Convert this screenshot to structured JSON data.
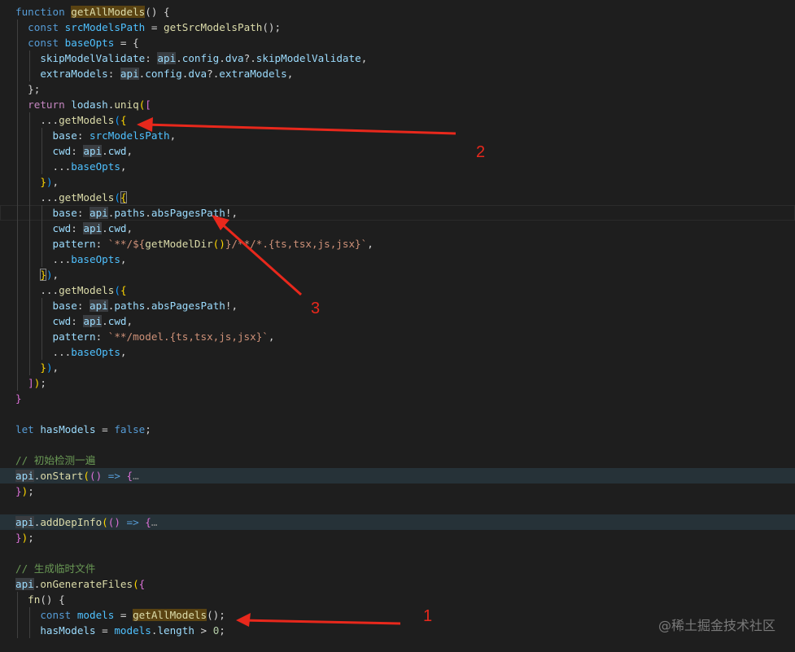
{
  "editor": {
    "lines": [
      {
        "indent": 0,
        "tokens": [
          [
            "function ",
            "kw"
          ],
          [
            "getAllModels",
            "fn",
            "match"
          ],
          [
            "() {",
            "plain"
          ]
        ]
      },
      {
        "indent": 1,
        "tokens": [
          [
            "const ",
            "kw"
          ],
          [
            "srcModelsPath",
            "const"
          ],
          [
            " = ",
            "plain"
          ],
          [
            "getSrcModelsPath",
            "fn"
          ],
          [
            "();",
            "plain"
          ]
        ]
      },
      {
        "indent": 1,
        "tokens": [
          [
            "const ",
            "kw"
          ],
          [
            "baseOpts",
            "const"
          ],
          [
            " = {",
            "plain"
          ]
        ]
      },
      {
        "indent": 2,
        "tokens": [
          [
            "skipModelValidate",
            "var"
          ],
          [
            ": ",
            "plain"
          ],
          [
            "api",
            "var",
            "api"
          ],
          [
            ".",
            "plain"
          ],
          [
            "config",
            "var"
          ],
          [
            ".",
            "plain"
          ],
          [
            "dva",
            "var"
          ],
          [
            "?.",
            "plain"
          ],
          [
            "skipModelValidate",
            "var"
          ],
          [
            ",",
            "plain"
          ]
        ]
      },
      {
        "indent": 2,
        "tokens": [
          [
            "extraModels",
            "var"
          ],
          [
            ": ",
            "plain"
          ],
          [
            "api",
            "var",
            "api"
          ],
          [
            ".",
            "plain"
          ],
          [
            "config",
            "var"
          ],
          [
            ".",
            "plain"
          ],
          [
            "dva",
            "var"
          ],
          [
            "?.",
            "plain"
          ],
          [
            "extraModels",
            "var"
          ],
          [
            ",",
            "plain"
          ]
        ]
      },
      {
        "indent": 1,
        "tokens": [
          [
            "};",
            "plain"
          ]
        ]
      },
      {
        "indent": 1,
        "tokens": [
          [
            "return ",
            "ctrl"
          ],
          [
            "lodash",
            "var"
          ],
          [
            ".",
            "plain"
          ],
          [
            "uniq",
            "fn"
          ],
          [
            "(",
            "p1"
          ],
          [
            "[",
            "p2"
          ]
        ]
      },
      {
        "indent": 2,
        "tokens": [
          [
            "...",
            "plain"
          ],
          [
            "getModels",
            "fn"
          ],
          [
            "(",
            "p3"
          ],
          [
            "{",
            "p1"
          ]
        ]
      },
      {
        "indent": 3,
        "tokens": [
          [
            "base",
            "var"
          ],
          [
            ": ",
            "plain"
          ],
          [
            "srcModelsPath",
            "const"
          ],
          [
            ",",
            "plain"
          ]
        ]
      },
      {
        "indent": 3,
        "tokens": [
          [
            "cwd",
            "var"
          ],
          [
            ": ",
            "plain"
          ],
          [
            "api",
            "var",
            "api"
          ],
          [
            ".",
            "plain"
          ],
          [
            "cwd",
            "var"
          ],
          [
            ",",
            "plain"
          ]
        ]
      },
      {
        "indent": 3,
        "tokens": [
          [
            "...",
            "plain"
          ],
          [
            "baseOpts",
            "const"
          ],
          [
            ",",
            "plain"
          ]
        ]
      },
      {
        "indent": 2,
        "tokens": [
          [
            "}",
            "p1"
          ],
          [
            ")",
            "p3"
          ],
          [
            ",",
            "plain"
          ]
        ]
      },
      {
        "indent": 2,
        "tokens": [
          [
            "...",
            "plain"
          ],
          [
            "getModels",
            "fn"
          ],
          [
            "(",
            "p3"
          ],
          [
            "{",
            "p1",
            "box"
          ]
        ]
      },
      {
        "indent": 3,
        "active": true,
        "tokens": [
          [
            "base",
            "var"
          ],
          [
            ": ",
            "plain"
          ],
          [
            "api",
            "var",
            "api"
          ],
          [
            ".",
            "plain"
          ],
          [
            "paths",
            "var"
          ],
          [
            ".",
            "plain"
          ],
          [
            "absPagesPath",
            "var"
          ],
          [
            "!,",
            "plain"
          ]
        ]
      },
      {
        "indent": 3,
        "tokens": [
          [
            "cwd",
            "var"
          ],
          [
            ": ",
            "plain"
          ],
          [
            "api",
            "var",
            "api"
          ],
          [
            ".",
            "plain"
          ],
          [
            "cwd",
            "var"
          ],
          [
            ",",
            "plain"
          ]
        ]
      },
      {
        "indent": 3,
        "tokens": [
          [
            "pattern",
            "var"
          ],
          [
            ": ",
            "plain"
          ],
          [
            "`**/${",
            "str"
          ],
          [
            "getModelDir",
            "fn"
          ],
          [
            "()",
            "p1"
          ],
          [
            "}/**/*.{ts,tsx,js,jsx}`",
            "str"
          ],
          [
            ",",
            "plain"
          ]
        ]
      },
      {
        "indent": 3,
        "tokens": [
          [
            "...",
            "plain"
          ],
          [
            "baseOpts",
            "const"
          ],
          [
            ",",
            "plain"
          ]
        ]
      },
      {
        "indent": 2,
        "tokens": [
          [
            "}",
            "p1",
            "box"
          ],
          [
            ")",
            "p3"
          ],
          [
            ",",
            "plain"
          ]
        ]
      },
      {
        "indent": 2,
        "tokens": [
          [
            "...",
            "plain"
          ],
          [
            "getModels",
            "fn"
          ],
          [
            "(",
            "p3"
          ],
          [
            "{",
            "p1"
          ]
        ]
      },
      {
        "indent": 3,
        "tokens": [
          [
            "base",
            "var"
          ],
          [
            ": ",
            "plain"
          ],
          [
            "api",
            "var",
            "api"
          ],
          [
            ".",
            "plain"
          ],
          [
            "paths",
            "var"
          ],
          [
            ".",
            "plain"
          ],
          [
            "absPagesPath",
            "var"
          ],
          [
            "!,",
            "plain"
          ]
        ]
      },
      {
        "indent": 3,
        "tokens": [
          [
            "cwd",
            "var"
          ],
          [
            ": ",
            "plain"
          ],
          [
            "api",
            "var",
            "api"
          ],
          [
            ".",
            "plain"
          ],
          [
            "cwd",
            "var"
          ],
          [
            ",",
            "plain"
          ]
        ]
      },
      {
        "indent": 3,
        "tokens": [
          [
            "pattern",
            "var"
          ],
          [
            ": ",
            "plain"
          ],
          [
            "`**/model.{ts,tsx,js,jsx}`",
            "str"
          ],
          [
            ",",
            "plain"
          ]
        ]
      },
      {
        "indent": 3,
        "tokens": [
          [
            "...",
            "plain"
          ],
          [
            "baseOpts",
            "const"
          ],
          [
            ",",
            "plain"
          ]
        ]
      },
      {
        "indent": 2,
        "tokens": [
          [
            "}",
            "p1"
          ],
          [
            ")",
            "p3"
          ],
          [
            ",",
            "plain"
          ]
        ]
      },
      {
        "indent": 1,
        "tokens": [
          [
            "]",
            "p2"
          ],
          [
            ")",
            "p1"
          ],
          [
            ";",
            "plain"
          ]
        ]
      },
      {
        "indent": 0,
        "tokens": [
          [
            "}",
            "p2"
          ]
        ]
      },
      {
        "indent": 0,
        "tokens": []
      },
      {
        "indent": 0,
        "tokens": [
          [
            "let ",
            "kw"
          ],
          [
            "hasModels",
            "var"
          ],
          [
            " = ",
            "plain"
          ],
          [
            "false",
            "kw"
          ],
          [
            ";",
            "plain"
          ]
        ]
      },
      {
        "indent": 0,
        "tokens": []
      },
      {
        "indent": 0,
        "tokens": [
          [
            "// 初始检测一遍",
            "com"
          ]
        ]
      },
      {
        "indent": 0,
        "hl": true,
        "tokens": [
          [
            "api",
            "var",
            "api"
          ],
          [
            ".",
            "plain"
          ],
          [
            "onStart",
            "fn"
          ],
          [
            "(",
            "p1"
          ],
          [
            "()",
            "p2"
          ],
          [
            " => ",
            "kw"
          ],
          [
            "{",
            "p2"
          ],
          [
            "…",
            "fold"
          ]
        ]
      },
      {
        "indent": 0,
        "tokens": [
          [
            "}",
            "p2"
          ],
          [
            ")",
            "p1"
          ],
          [
            ";",
            "plain"
          ]
        ]
      },
      {
        "indent": 0,
        "tokens": []
      },
      {
        "indent": 0,
        "hl": true,
        "tokens": [
          [
            "api",
            "var",
            "api"
          ],
          [
            ".",
            "plain"
          ],
          [
            "addDepInfo",
            "fn"
          ],
          [
            "(",
            "p1"
          ],
          [
            "()",
            "p2"
          ],
          [
            " => ",
            "kw"
          ],
          [
            "{",
            "p2"
          ],
          [
            "…",
            "fold"
          ]
        ]
      },
      {
        "indent": 0,
        "tokens": [
          [
            "}",
            "p2"
          ],
          [
            ")",
            "p1"
          ],
          [
            ";",
            "plain"
          ]
        ]
      },
      {
        "indent": 0,
        "tokens": []
      },
      {
        "indent": 0,
        "tokens": [
          [
            "// 生成临时文件",
            "com"
          ]
        ]
      },
      {
        "indent": 0,
        "tokens": [
          [
            "api",
            "var",
            "api"
          ],
          [
            ".",
            "plain"
          ],
          [
            "onGenerateFiles",
            "fn"
          ],
          [
            "(",
            "p1"
          ],
          [
            "{",
            "p2"
          ]
        ]
      },
      {
        "indent": 1,
        "tokens": [
          [
            "fn",
            "fn"
          ],
          [
            "() {",
            "plain"
          ]
        ]
      },
      {
        "indent": 2,
        "tokens": [
          [
            "const ",
            "kw"
          ],
          [
            "models",
            "const"
          ],
          [
            " = ",
            "plain"
          ],
          [
            "getAllModels",
            "fn",
            "match"
          ],
          [
            "();",
            "plain"
          ]
        ]
      },
      {
        "indent": 2,
        "tokens": [
          [
            "hasModels",
            "var"
          ],
          [
            " = ",
            "plain"
          ],
          [
            "models",
            "const"
          ],
          [
            ".",
            "plain"
          ],
          [
            "length",
            "var"
          ],
          [
            " > ",
            "plain"
          ],
          [
            "0",
            "num"
          ],
          [
            ";",
            "plain"
          ]
        ]
      }
    ]
  },
  "annotations": {
    "arrow_color": "#e8281c",
    "label_1": "1",
    "label_2": "2",
    "label_3": "3"
  },
  "watermark": {
    "text": "@稀土掘金技术社区"
  }
}
